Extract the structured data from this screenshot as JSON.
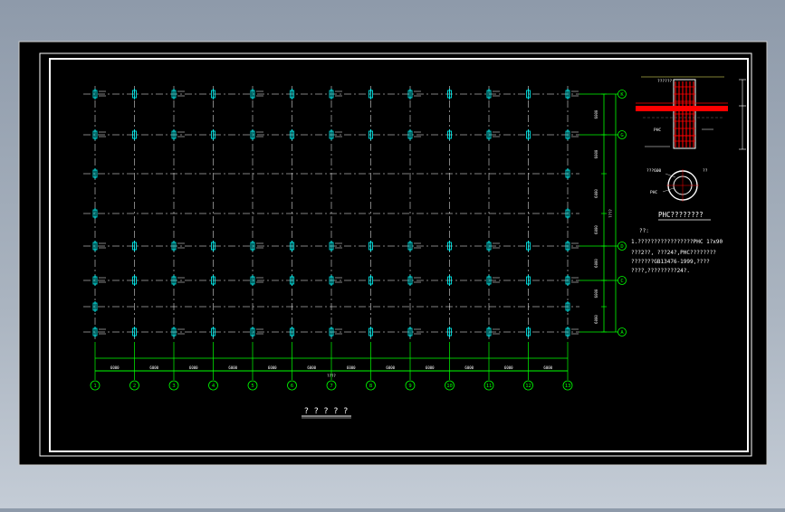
{
  "drawing": {
    "title": "? ? ? ? ?",
    "total_width_label": "????",
    "col_dim_label": "6000",
    "total_height_label": "????",
    "row_dim_label": "6000"
  },
  "grid": {
    "columns": [
      "1",
      "2",
      "3",
      "4",
      "5",
      "6",
      "7",
      "8",
      "9",
      "10",
      "11",
      "12",
      "13"
    ],
    "rows": [
      "K",
      "G",
      "E",
      "F",
      "D",
      "C",
      "B",
      "A"
    ],
    "labeled_rows": [
      "K",
      "G",
      "D",
      "C",
      "A"
    ]
  },
  "detail": {
    "section_title": "PHC????????",
    "pile_label": "PHC",
    "pile_top_label": "??????",
    "ring_label_top": "???600",
    "ring_label_bottom": "PHC",
    "ring_label_right": "??",
    "notes_heading": "??:",
    "notes": [
      "1.?????????????????PHC 1?x90",
      "???2??,  ???24?,PHC????????",
      "???????GB13476-1999,????",
      "????,?????????24?."
    ]
  },
  "colors": {
    "background": "#000000",
    "grid_line": "#ffffff",
    "axis": "#00ff00",
    "column": "#00ffff",
    "reinforcement": "#ff0000"
  }
}
